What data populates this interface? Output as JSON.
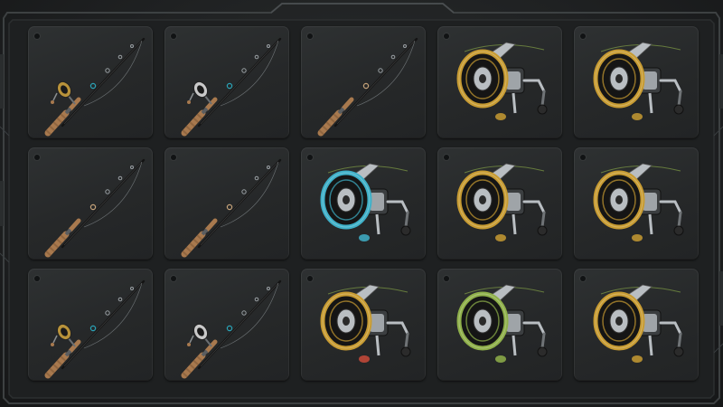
{
  "inventory": {
    "columns": 5,
    "rows": 3,
    "slots": [
      {
        "item": "spinning-rod-with-reel",
        "reel_color": "#b8923a",
        "accent": "#2aa4b8"
      },
      {
        "item": "spinning-rod-with-reel",
        "reel_color": "#c9c9c9",
        "accent": "#2aa4b8"
      },
      {
        "item": "bare-rod",
        "reel_color": "",
        "accent": "#c6a37a"
      },
      {
        "item": "spinning-reel",
        "reel_color": "#c79b32",
        "accent": "#c79b32"
      },
      {
        "item": "spinning-reel",
        "reel_color": "#c79b32",
        "accent": "#c79b32"
      },
      {
        "item": "bare-rod",
        "reel_color": "",
        "accent": "#c6a37a"
      },
      {
        "item": "bare-rod",
        "reel_color": "",
        "accent": "#c6a37a"
      },
      {
        "item": "spinning-reel",
        "reel_color": "#3fb0c8",
        "accent": "#3fb0c8"
      },
      {
        "item": "spinning-reel",
        "reel_color": "#c79b32",
        "accent": "#c79b32"
      },
      {
        "item": "spinning-reel",
        "reel_color": "#c79b32",
        "accent": "#c79b32"
      },
      {
        "item": "spinning-rod-with-reel",
        "reel_color": "#b8923a",
        "accent": "#2aa4b8"
      },
      {
        "item": "spinning-rod-with-reel",
        "reel_color": "#c9c9c9",
        "accent": "#2aa4b8"
      },
      {
        "item": "spinning-reel",
        "reel_color": "#c79b32",
        "accent": "#c94a3a"
      },
      {
        "item": "spinning-reel",
        "reel_color": "#8fb04a",
        "accent": "#8fb04a"
      },
      {
        "item": "spinning-reel",
        "reel_color": "#c79b32",
        "accent": "#c79b32"
      }
    ]
  },
  "colors": {
    "frame": "#2f3233",
    "slot": "#2a2c2d",
    "cork": "#a8794e",
    "blank": "#141414",
    "metal": "#b9bec2"
  }
}
